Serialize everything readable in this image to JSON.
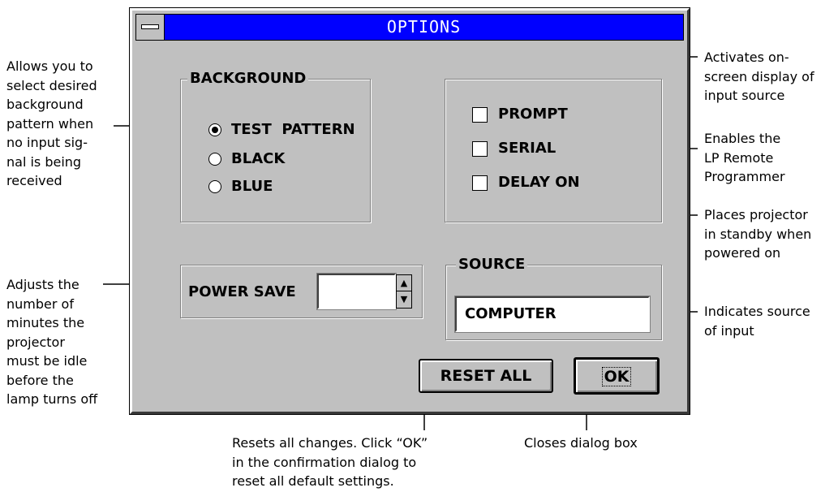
{
  "window": {
    "title": "OPTIONS",
    "titlebar_color": "#0000ff",
    "face_color": "#c0c0c0"
  },
  "background_group": {
    "label": "BACKGROUND",
    "options": [
      {
        "label": "TEST  PATTERN",
        "selected": true
      },
      {
        "label": "BLACK",
        "selected": false
      },
      {
        "label": "BLUE",
        "selected": false
      }
    ]
  },
  "checkboxes": [
    {
      "label": "PROMPT",
      "checked": false
    },
    {
      "label": "SERIAL",
      "checked": false
    },
    {
      "label": "DELAY ON",
      "checked": false
    }
  ],
  "power_save": {
    "label": "POWER SAVE",
    "value": ""
  },
  "source": {
    "label": "SOURCE",
    "value": "COMPUTER"
  },
  "buttons": {
    "reset_all": "RESET ALL",
    "ok": "OK"
  },
  "callouts": {
    "background": [
      "Allows you to",
      "select desired",
      "background",
      "pattern when",
      "no input sig-",
      "nal is being",
      "received"
    ],
    "power_save": [
      "Adjusts the",
      "number of",
      "minutes the",
      "projector",
      "must be idle",
      "before the",
      "lamp turns off"
    ],
    "prompt": [
      "Activates on-",
      "screen display of",
      "input source"
    ],
    "serial": [
      "Enables the",
      "LP Remote",
      "Programmer"
    ],
    "delay_on": [
      "Places projector",
      "in standby when",
      "powered on"
    ],
    "source": [
      "Indicates source",
      "of input"
    ],
    "reset_all": [
      "Resets all changes. Click “OK”",
      "in the confirmation dialog to",
      "reset all default settings."
    ],
    "ok": [
      "Closes dialog box"
    ]
  }
}
